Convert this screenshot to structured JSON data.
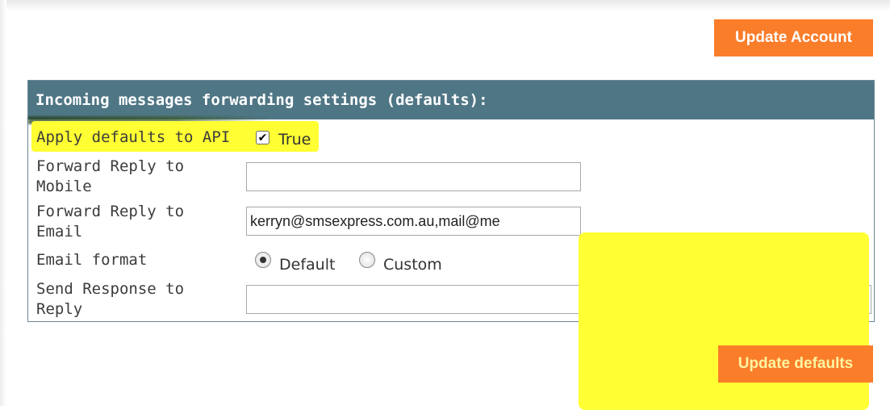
{
  "buttons": {
    "update_account": "Update Account",
    "update_defaults": "Update defaults"
  },
  "panel": {
    "title": "Incoming messages forwarding settings (defaults):"
  },
  "rows": {
    "apply_defaults": {
      "label": "Apply defaults to API",
      "checked": true,
      "checkbox_text": "True"
    },
    "forward_mobile": {
      "label_line1": "Forward Reply to",
      "label_line2": "Mobile",
      "value": ""
    },
    "forward_email": {
      "label_line1": "Forward Reply to",
      "label_line2": "Email",
      "value": "kerryn@smsexpress.com.au,mail@me"
    },
    "email_format": {
      "label": "Email format",
      "options": [
        "Default",
        "Custom"
      ],
      "selected": "Default"
    },
    "send_response": {
      "label_line1": "Send Response to",
      "label_line2": "Reply",
      "value": ""
    }
  },
  "colors": {
    "accent_button": "#fa7d2a",
    "panel_header": "#4f7685",
    "highlight": "#ffff33"
  },
  "icons": {
    "checkbox": "checkmark-icon",
    "radio": "radio-dot-icon"
  }
}
